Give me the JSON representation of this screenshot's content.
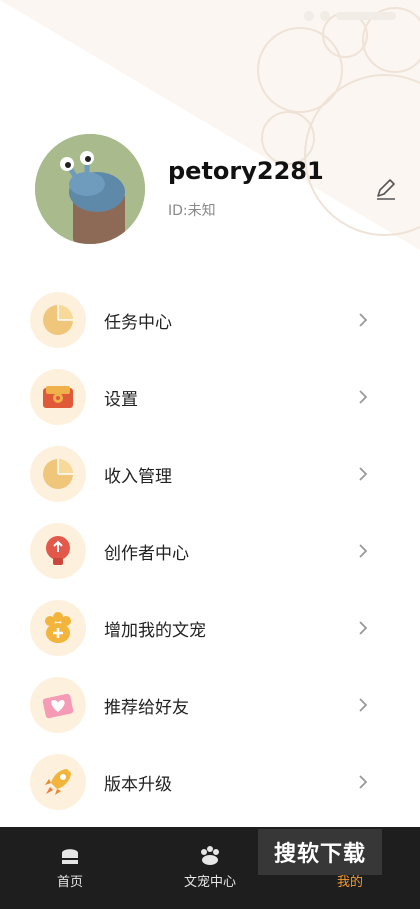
{
  "profile": {
    "username": "petory2281",
    "user_id": "ID:未知"
  },
  "menu": [
    {
      "label": "任务中心",
      "icon": "task-pie-icon"
    },
    {
      "label": "设置",
      "icon": "settings-box-icon"
    },
    {
      "label": "收入管理",
      "icon": "income-pie-icon"
    },
    {
      "label": "创作者中心",
      "icon": "creator-bulb-icon"
    },
    {
      "label": "增加我的文宠",
      "icon": "paw-icon"
    },
    {
      "label": "推荐给好友",
      "icon": "heart-envelope-icon"
    },
    {
      "label": "版本升级",
      "icon": "rocket-icon"
    }
  ],
  "nav": {
    "home": "首页",
    "pet_center": "文宠中心",
    "mine": "我的"
  },
  "watermark": "搜软下载",
  "colors": {
    "accent": "#f39a2d",
    "icon_bg": "#fdf1de",
    "nav_bg": "#1e1e1e"
  }
}
